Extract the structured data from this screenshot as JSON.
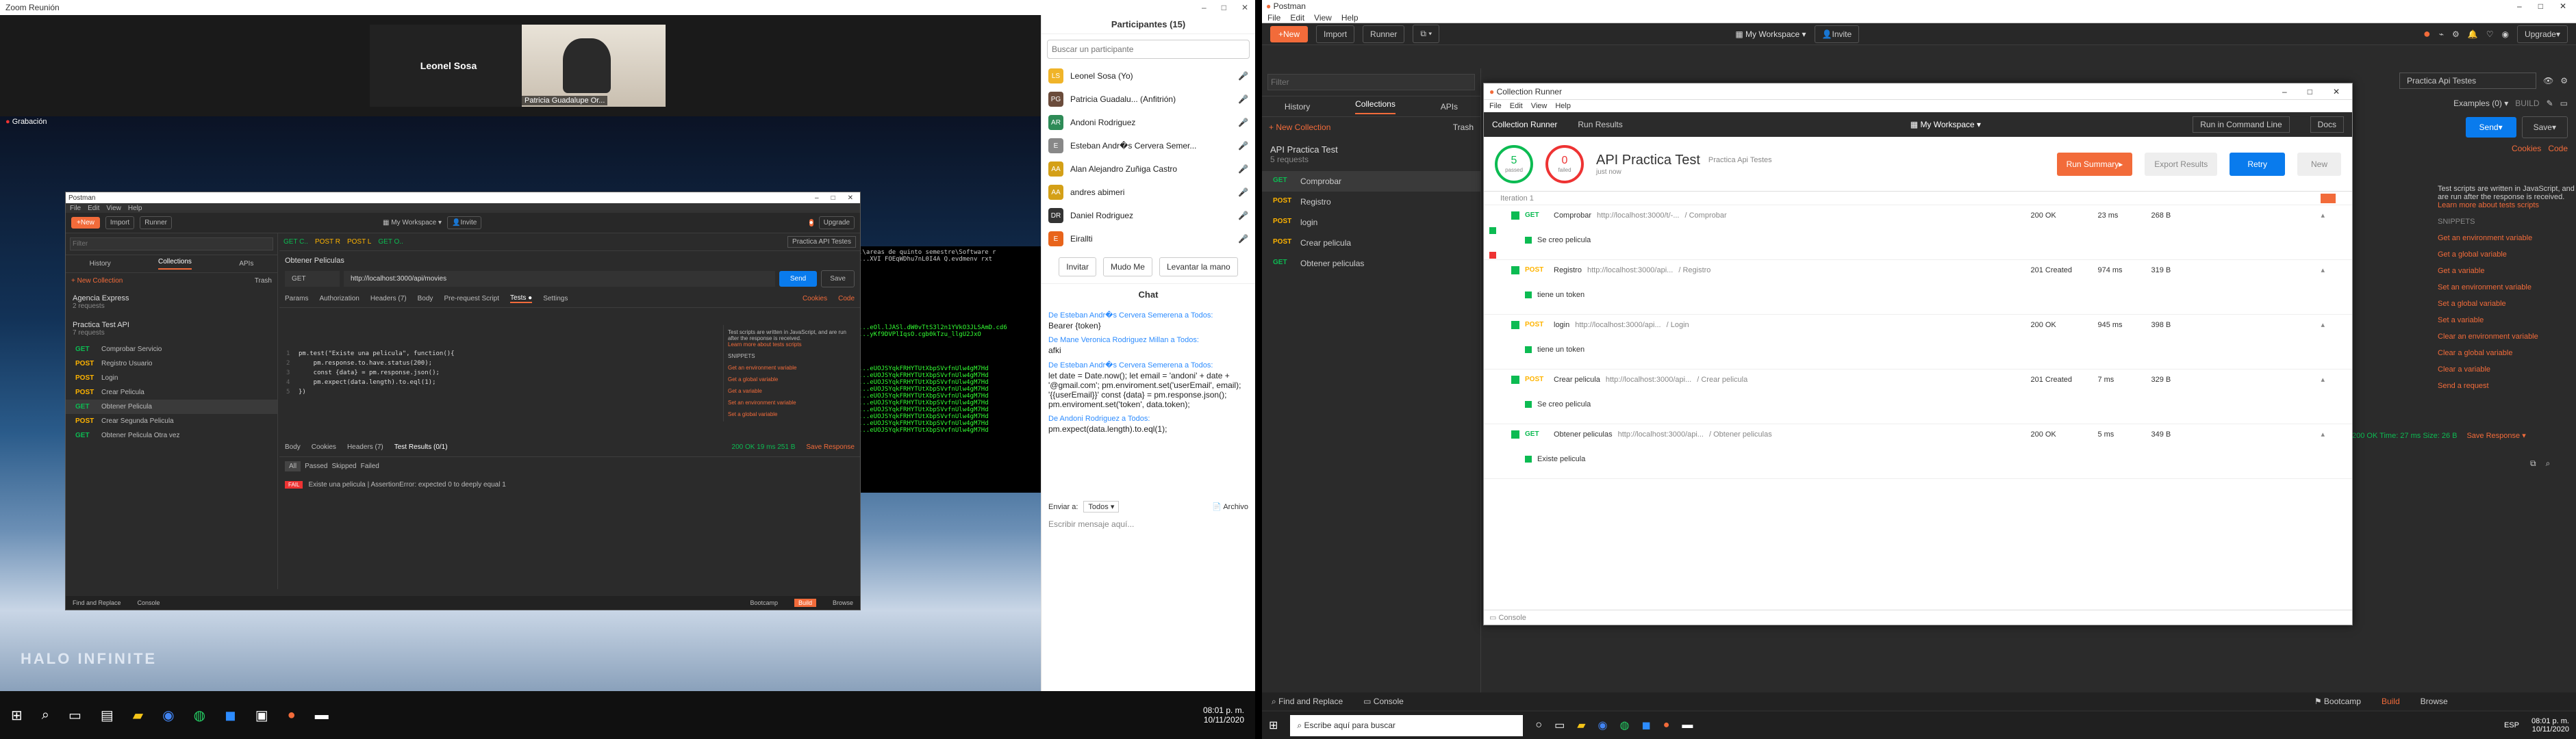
{
  "zoom": {
    "title": "Zoom Reunión",
    "host_name": "Leonel Sosa",
    "video_caption": "Patricia Guadalupe Or...",
    "recording_label": "Grabación",
    "participants": {
      "title": "Participantes (15)",
      "search_placeholder": "Buscar un participante",
      "list": [
        {
          "initials": "LS",
          "name": "Leonel Sosa (Yo)",
          "color": "#f0b429"
        },
        {
          "initials": "PG",
          "name": "Patricia Guadalu... (Anfitrión)",
          "color": "#6b4c3b"
        },
        {
          "initials": "AR",
          "name": "Andoni Rodriguez",
          "color": "#2e8b57"
        },
        {
          "initials": "E",
          "name": "Esteban Andr�s Cervera Semer...",
          "color": "#888"
        },
        {
          "initials": "AA",
          "name": "Alan Alejandro Zuñiga Castro",
          "color": "#d4a017"
        },
        {
          "initials": "AA",
          "name": "andres abimeri",
          "color": "#d4a017"
        },
        {
          "initials": "DR",
          "name": "Daniel Rodriguez",
          "color": "#333"
        },
        {
          "initials": "E",
          "name": "Eirallti",
          "color": "#e8641b"
        }
      ],
      "invite": "Invitar",
      "mute_all": "Mudo Me",
      "raise": "Levantar la mano"
    },
    "chat": {
      "title": "Chat",
      "messages": [
        {
          "from": "De Esteban Andr�s Cervera Semerena a Todos:",
          "text": "Bearer {token}"
        },
        {
          "from": "De Mane Veronica Rodriguez Millan a Todos:",
          "text": "afki"
        },
        {
          "from": "De Esteban Andr�s Cervera Semerena a Todos:",
          "text": "let date = Date.now(); let email = 'andoni' + date + '@gmail.com'; pm.enviroment.set('userEmail', email); '{{userEmail}}' const {data} = pm.response.json(); pm.enviroment.set('token', data.token);"
        },
        {
          "from": "De Andoni Rodriguez a Todos:",
          "text": "pm.expect(data.length).to.eql(1);"
        }
      ],
      "send_to": "Enviar a:",
      "send_to_value": "Todos",
      "file": "Archivo",
      "input_placeholder": "Escribir mensaje aquí..."
    },
    "wallpaper_text": "HALO INFINITE",
    "clock": {
      "time": "08:01 p. m.",
      "date": "10/11/2020"
    }
  },
  "small_postman": {
    "title": "Postman",
    "menu": [
      "File",
      "Edit",
      "View",
      "Help"
    ],
    "new": "New",
    "import": "Import",
    "runner": "Runner",
    "workspace": "My Workspace",
    "invite": "Invite",
    "upgrade": "Upgrade",
    "tabs": [
      "History",
      "Collections",
      "APIs"
    ],
    "filter_placeholder": "Filter",
    "new_collection": "New Collection",
    "trash": "Trash",
    "collections": [
      {
        "name": "Agencia Express",
        "sub": "2 requests"
      },
      {
        "name": "Practica Test API",
        "sub": "7 requests"
      }
    ],
    "requests": [
      {
        "m": "GET",
        "n": "Comprobar Servicio"
      },
      {
        "m": "POST",
        "n": "Registro Usuario"
      },
      {
        "m": "POST",
        "n": "Login"
      },
      {
        "m": "POST",
        "n": "Crear Pelicula"
      },
      {
        "m": "GET",
        "n": "Obtener Pelicula"
      },
      {
        "m": "POST",
        "n": "Crear Segunda Pelicula"
      },
      {
        "m": "GET",
        "n": "Obtener Pelicula Otra vez"
      }
    ],
    "env": "Practica API Testes",
    "request_title": "Obtener Peliculas",
    "method": "GET",
    "url": "http://localhost:3000/api/movies",
    "send": "Send",
    "save": "Save",
    "req_tabs": [
      "Params",
      "Authorization",
      "Headers (7)",
      "Body",
      "Pre-request Script",
      "Tests ●",
      "Settings"
    ],
    "cookies": "Cookies",
    "code": "Code",
    "code_lines": [
      "pm.test(\"Existe una pelicula\", function(){",
      "    pm.response.to.have.status(200);",
      "    const {data} = pm.response.json();",
      "    pm.expect(data.length).to.eql(1);",
      "})"
    ],
    "snippet_intro": "Test scripts are written in JavaScript, and are run after the response is received.",
    "snippet_link": "Learn more about tests scripts",
    "snippets_title": "SNIPPETS",
    "snippets": [
      "Get an environment variable",
      "Get a global variable",
      "Get a variable",
      "Set an environment variable",
      "Set a global variable"
    ],
    "resp_tabs": [
      "Body",
      "Cookies",
      "Headers (7)",
      "Test Results (0/1)"
    ],
    "resp_stats": "200 OK   19 ms   251 B",
    "save_response": "Save Response",
    "filter_tabs": [
      "All",
      "Passed",
      "Skipped",
      "Failed"
    ],
    "fail_badge": "FAIL",
    "fail_text": "Existe una pelicula | AssertionError: expected 0 to deeply equal 1",
    "footer": [
      "Find and Replace",
      "Console",
      "Bootcamp",
      "Build",
      "Browse"
    ]
  },
  "postman": {
    "title": "Postman",
    "menu": [
      "File",
      "Edit",
      "View",
      "Help"
    ],
    "new": "New",
    "import": "Import",
    "runner": "Runner",
    "workspace": "My Workspace",
    "invite": "Invite",
    "upgrade": "Upgrade",
    "tabs": [
      "History",
      "Collections",
      "APIs"
    ],
    "filter_placeholder": "Filter",
    "new_collection": "New Collection",
    "trash": "Trash",
    "collection": {
      "name": "API Practica Test",
      "sub": "5 requests"
    },
    "requests": [
      {
        "m": "GET",
        "n": "Comprobar"
      },
      {
        "m": "POST",
        "n": "Registro"
      },
      {
        "m": "POST",
        "n": "login"
      },
      {
        "m": "POST",
        "n": "Crear pelicula"
      },
      {
        "m": "GET",
        "n": "Obtener peliculas"
      }
    ],
    "env": "Practica Api Testes",
    "examples": "Examples",
    "examples_count": "0",
    "build": "BUILD",
    "send": "Send",
    "save": "Save",
    "cookies": "Cookies",
    "code": "Code",
    "snippet_intro": "Test scripts are written in JavaScript, and are run after the response is received.",
    "snippet_link": "Learn more about tests scripts",
    "snippets_title": "SNIPPETS",
    "snippets": [
      "Get an environment variable",
      "Get a global variable",
      "Get a variable",
      "Set an environment variable",
      "Set a global variable",
      "Set a variable",
      "Clear an environment variable",
      "Clear a global variable",
      "Clear a variable",
      "Send a request"
    ],
    "resp_stats": "200 OK   Time: 27 ms   Size: 26 B",
    "save_response": "Save Response",
    "footer": [
      "Find and Replace",
      "Console",
      "Bootcamp",
      "Build",
      "Browse"
    ]
  },
  "runner": {
    "title": "Collection Runner",
    "menu": [
      "File",
      "Edit",
      "View",
      "Help"
    ],
    "tabs": [
      "Collection Runner",
      "Run Results"
    ],
    "workspace": "My Workspace",
    "cmdline": "Run in Command Line",
    "docs": "Docs",
    "passed": "5",
    "passed_label": "passed",
    "failed": "0",
    "failed_label": "failed",
    "run_name": "API Practica Test",
    "env": "Practica Api Testes",
    "time": "just now",
    "run_summary": "Run Summary",
    "export": "Export Results",
    "retry": "Retry",
    "new": "New",
    "iteration": "Iteration 1",
    "results": [
      {
        "m": "GET",
        "n": "Comprobar",
        "url": "http://localhost:3000/t/-...",
        "path": "/ Comprobar",
        "status": "200 OK",
        "time": "23 ms",
        "size": "268 B",
        "test": "Se creo pelicula"
      },
      {
        "m": "POST",
        "n": "Registro",
        "url": "http://localhost:3000/api...",
        "path": "/ Registro",
        "status": "201 Created",
        "time": "974 ms",
        "size": "319 B",
        "test": "tiene un token"
      },
      {
        "m": "POST",
        "n": "login",
        "url": "http://localhost:3000/api...",
        "path": "/ Login",
        "status": "200 OK",
        "time": "945 ms",
        "size": "398 B",
        "test": "tiene un token"
      },
      {
        "m": "POST",
        "n": "Crear pelicula",
        "url": "http://localhost:3000/api...",
        "path": "/ Crear pelicula",
        "status": "201 Created",
        "time": "7 ms",
        "size": "329 B",
        "test": "Se creo pelicula"
      },
      {
        "m": "GET",
        "n": "Obtener peliculas",
        "url": "http://localhost:3000/api...",
        "path": "/ Obtener peliculas",
        "status": "200 OK",
        "time": "5 ms",
        "size": "349 B",
        "test": "Existe pelicula"
      }
    ],
    "console": "Console"
  },
  "taskbar": {
    "search_placeholder": "Escribe aquí para buscar",
    "lang": "ESP",
    "time": "08:01 p. m.",
    "date": "10/11/2020"
  }
}
